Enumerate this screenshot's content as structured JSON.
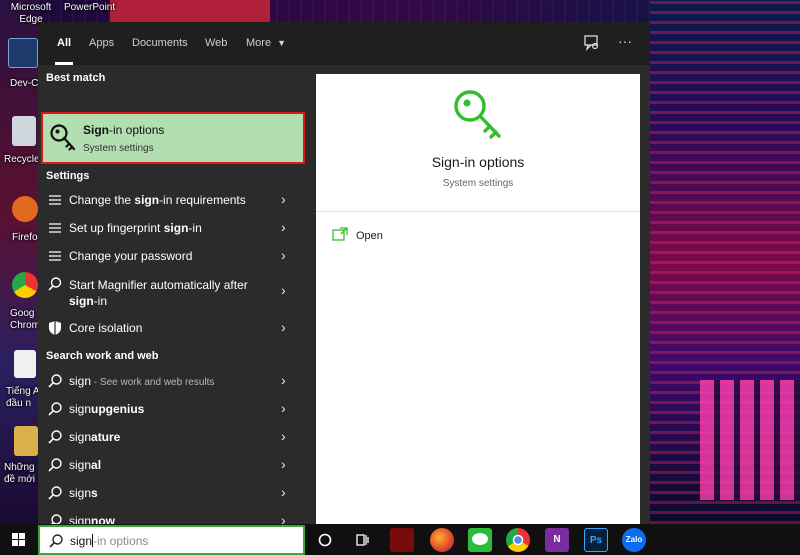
{
  "desktop": {
    "icons": [
      {
        "label": "Microsoft\nEdge",
        "icon": "edge-icon"
      },
      {
        "label": "PowerPoint",
        "icon": "powerpoint-icon"
      },
      {
        "label": "Dev-C",
        "icon": "devcpp-icon"
      },
      {
        "label": "Recycle",
        "icon": "recycle-bin-icon"
      },
      {
        "label": "Firefo",
        "icon": "firefox-icon"
      },
      {
        "label": "Goog\nChrom",
        "icon": "chrome-icon"
      },
      {
        "label": "Tiếng A\nđầu n",
        "icon": "file-icon"
      },
      {
        "label": "Những\nđề mới t",
        "icon": "folder-icon"
      }
    ]
  },
  "search": {
    "tabs": [
      "All",
      "Apps",
      "Documents",
      "Web",
      "More"
    ],
    "active_tab": "All",
    "header_icons": [
      "feedback-icon",
      "more-options-icon"
    ],
    "sections": {
      "best_match": "Best match",
      "settings": "Settings",
      "search_web": "Search work and web"
    },
    "best_match": {
      "title_bold": "Sign",
      "title_rest": "-in options",
      "subtitle": "System settings",
      "icon": "key-icon"
    },
    "settings_items": [
      {
        "pre": "Change the ",
        "bold": "sign",
        "post": "-in requirements",
        "icon": "settings-list-icon"
      },
      {
        "pre": "Set up fingerprint ",
        "bold": "sign",
        "post": "-in",
        "icon": "settings-list-icon"
      },
      {
        "pre": "Change your password",
        "bold": "",
        "post": "",
        "icon": "settings-list-icon"
      },
      {
        "pre": "Start Magnifier automatically after",
        "bold": "sign",
        "post": "-in",
        "icon": "magnifier-icon"
      },
      {
        "pre": "Core isolation",
        "bold": "",
        "post": "",
        "icon": "shield-icon"
      }
    ],
    "web_items": [
      {
        "normal": "sign",
        "bold": "",
        "hint": " - See work and web results"
      },
      {
        "normal": "sign",
        "bold": "upgenius",
        "hint": ""
      },
      {
        "normal": "sign",
        "bold": "ature",
        "hint": ""
      },
      {
        "normal": "sign",
        "bold": "al",
        "hint": ""
      },
      {
        "normal": "sign",
        "bold": "s",
        "hint": ""
      },
      {
        "normal": "sign",
        "bold": "now",
        "hint": ""
      }
    ],
    "preview": {
      "title": "Sign-in options",
      "subtitle": "System settings",
      "action_label": "Open",
      "icon": "key-icon"
    },
    "query": "sign",
    "query_ghost": "-in options",
    "colors": {
      "accent_green": "#3da53a",
      "highlight": "#b2dfb0",
      "highlight_border": "#e01818"
    }
  },
  "taskbar": {
    "pinned": [
      "cortana-icon",
      "task-view-icon",
      "app-red-icon",
      "firefox-icon",
      "line-icon",
      "chrome-icon",
      "onenote-icon",
      "photoshop-icon",
      "zalo-icon"
    ],
    "labels": {
      "onenote": "N",
      "photoshop": "Ps",
      "zalo": "Zalo"
    }
  }
}
